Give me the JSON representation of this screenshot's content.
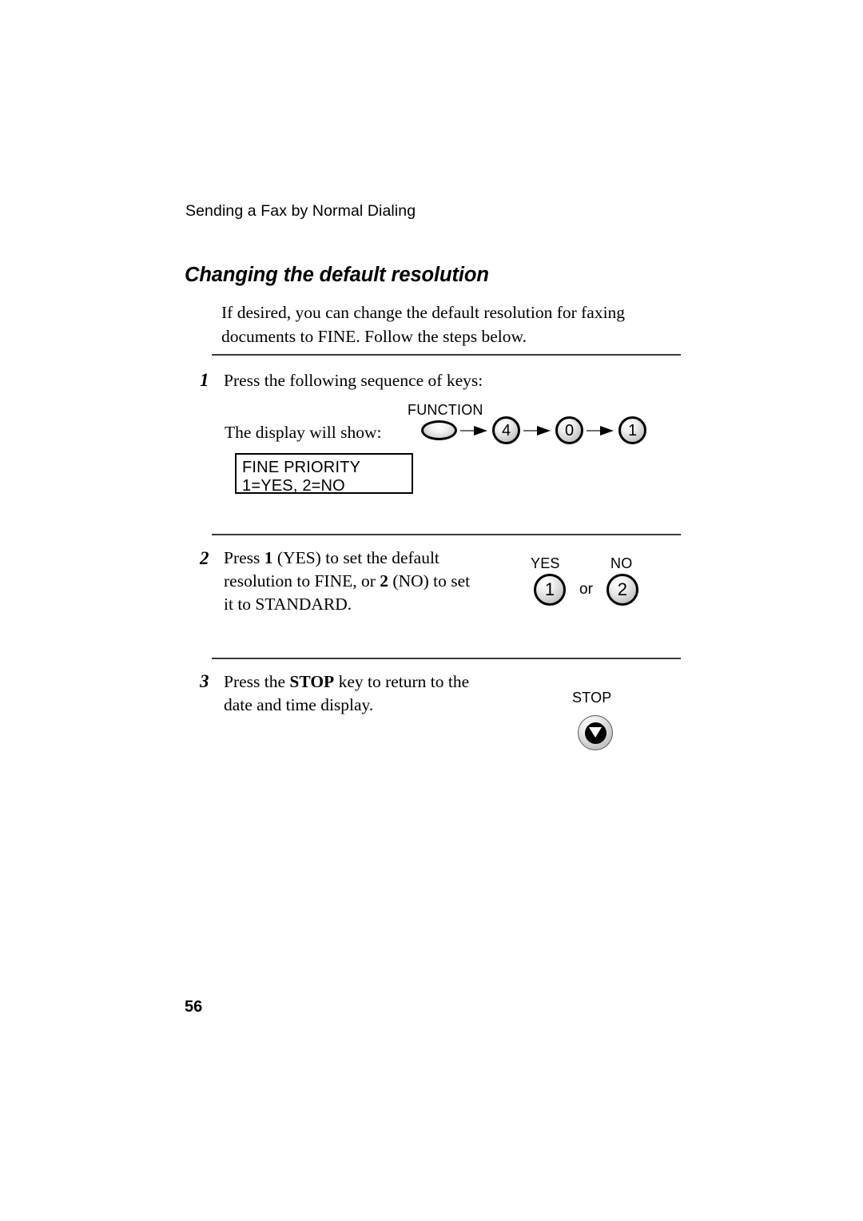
{
  "page": {
    "running_head": "Sending a Fax by Normal Dialing",
    "heading": "Changing the default resolution",
    "intro": "If desired, you can change the default resolution for faxing documents to FINE. Follow the steps below.",
    "page_number": "56"
  },
  "step1": {
    "number": "1",
    "text": "Press the following sequence of keys:",
    "display_label": "The display will show:",
    "function_key_label": "FUNCTION",
    "keys": [
      "4",
      "0",
      "1"
    ],
    "lcd_line1": "FINE PRIORITY",
    "lcd_line2": "1=YES, 2=NO"
  },
  "step2": {
    "number": "2",
    "text_part1": "Press ",
    "text_bold1": "1",
    "text_part2": " (YES) to set the default resolution to FINE, or ",
    "text_bold2": "2",
    "text_part3": " (NO) to set it to STANDARD.",
    "yes_label": "YES",
    "no_label": "NO",
    "yes_key": "1",
    "no_key": "2",
    "or_text": "or"
  },
  "step3": {
    "number": "3",
    "text_part1": "Press the ",
    "text_bold1": "STOP",
    "text_part2": " key to return to the date and time display.",
    "stop_label": "STOP"
  }
}
